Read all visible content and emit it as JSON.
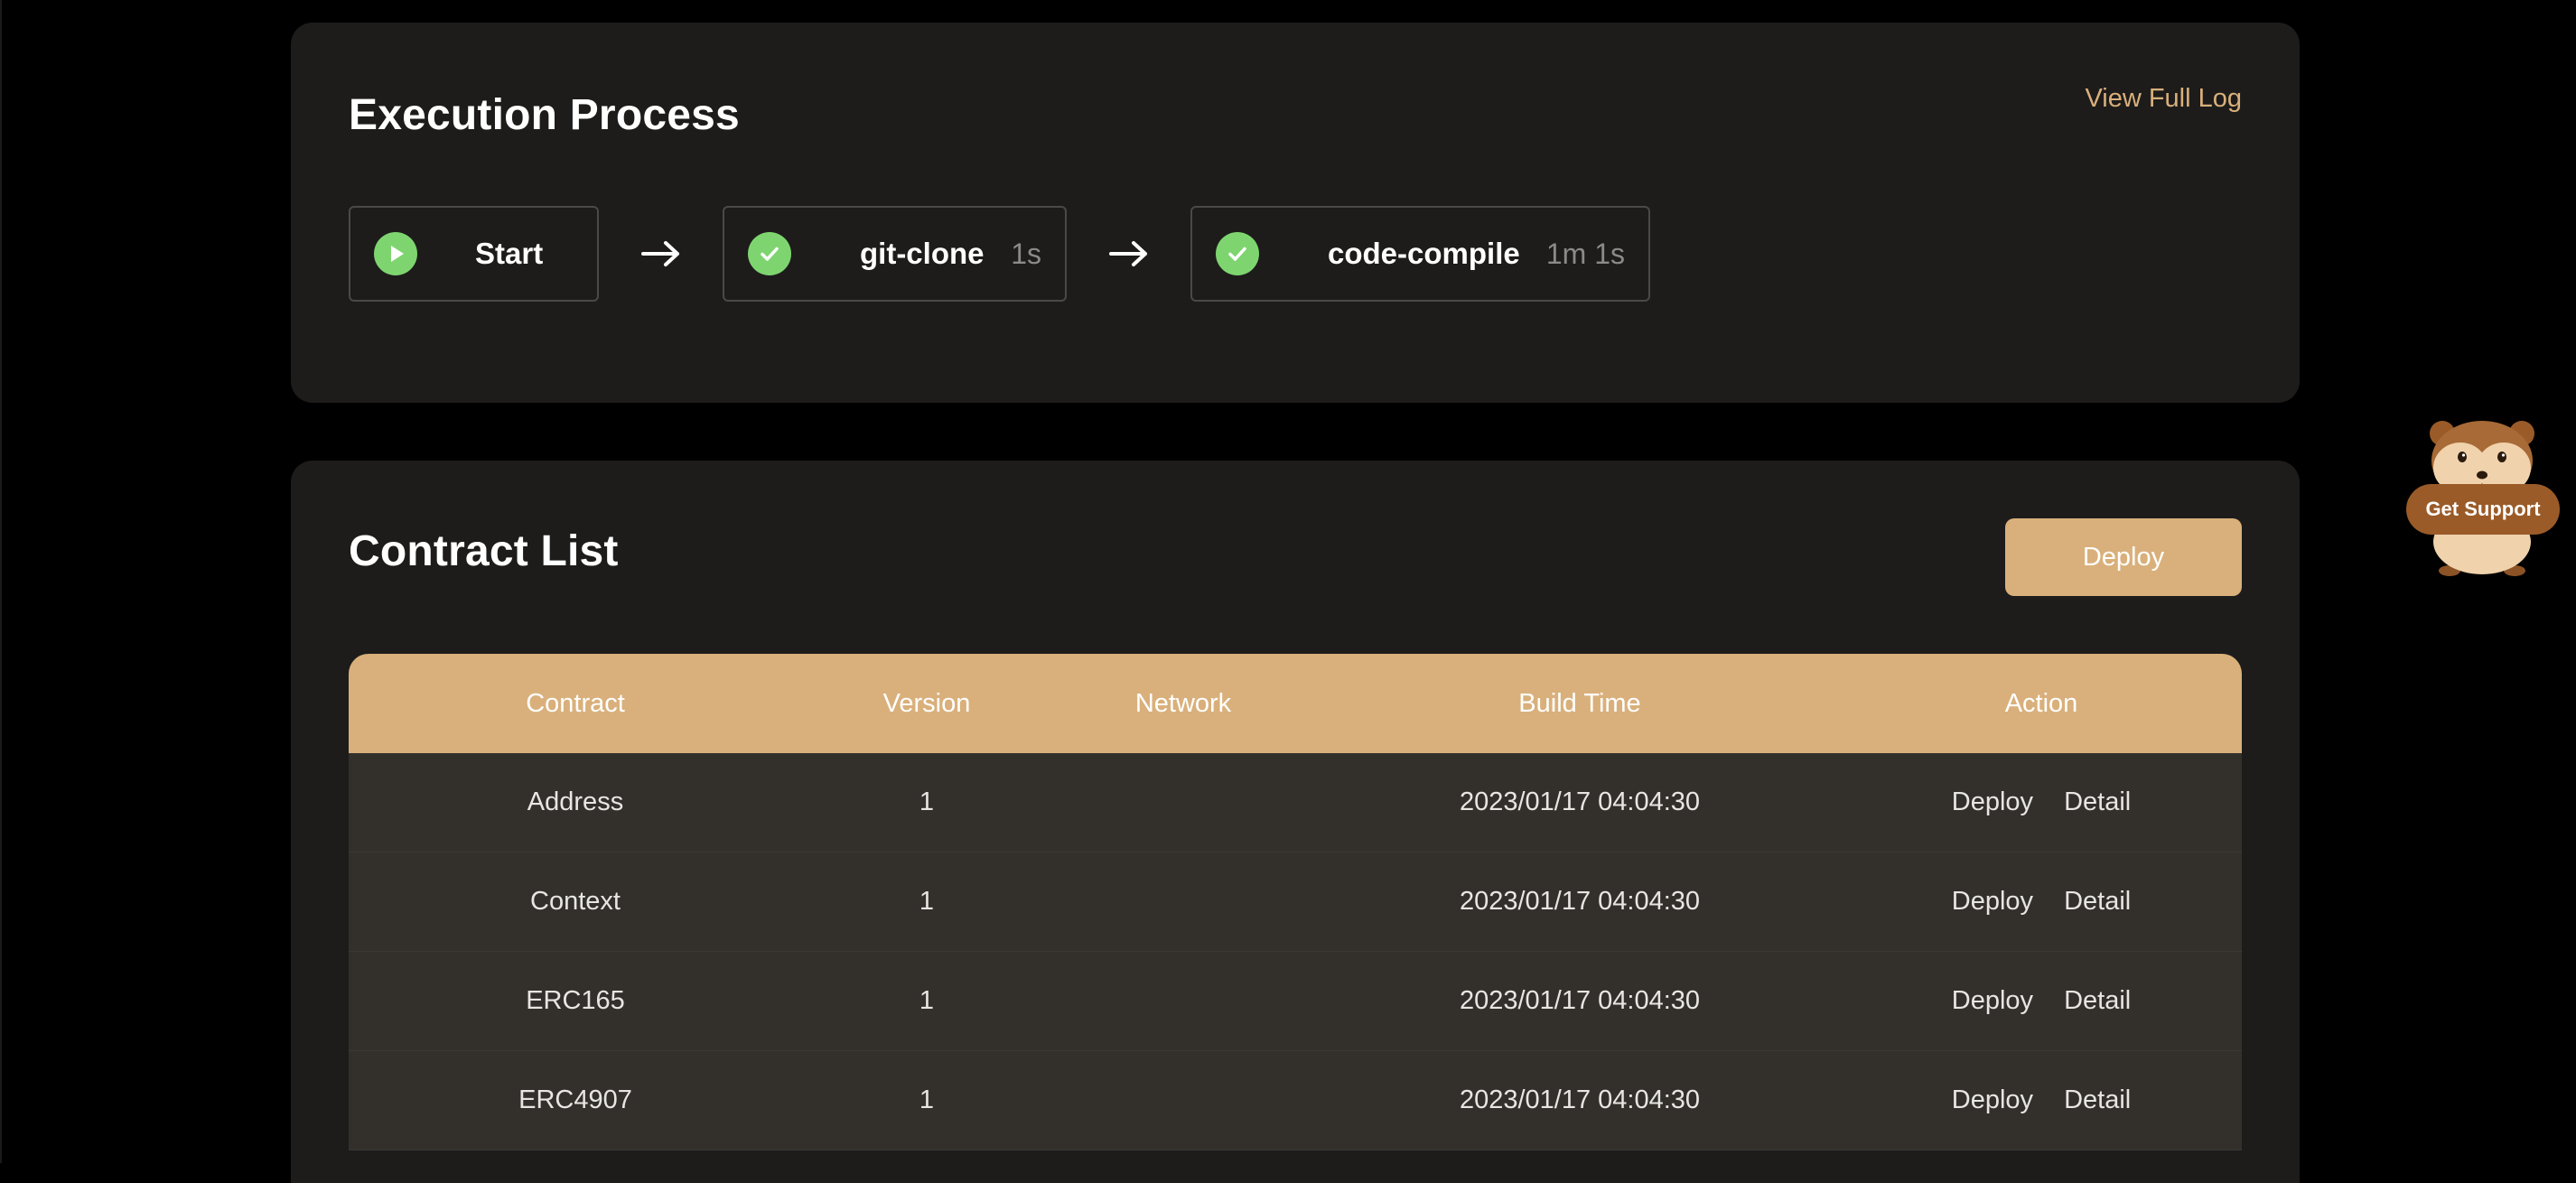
{
  "execution": {
    "title": "Execution Process",
    "view_log_label": "View Full Log",
    "steps": [
      {
        "name": "Start",
        "duration": "",
        "status": "running",
        "icon": "play-icon"
      },
      {
        "name": "git-clone",
        "duration": "1s",
        "status": "success",
        "icon": "check-icon"
      },
      {
        "name": "code-compile",
        "duration": "1m 1s",
        "status": "success",
        "icon": "check-icon"
      }
    ]
  },
  "contracts": {
    "title": "Contract List",
    "deploy_label": "Deploy",
    "columns": [
      "Contract",
      "Version",
      "Network",
      "Build Time",
      "Action"
    ],
    "rows": [
      {
        "contract": "Address",
        "version": "1",
        "network": "",
        "build_time": "2023/01/17 04:04:30",
        "deploy": "Deploy",
        "detail": "Detail"
      },
      {
        "contract": "Context",
        "version": "1",
        "network": "",
        "build_time": "2023/01/17 04:04:30",
        "deploy": "Deploy",
        "detail": "Detail"
      },
      {
        "contract": "ERC165",
        "version": "1",
        "network": "",
        "build_time": "2023/01/17 04:04:30",
        "deploy": "Deploy",
        "detail": "Detail"
      },
      {
        "contract": "ERC4907",
        "version": "1",
        "network": "",
        "build_time": "2023/01/17 04:04:30",
        "deploy": "Deploy",
        "detail": "Detail"
      }
    ]
  },
  "support": {
    "label": "Get Support",
    "icon": "hamster-mascot-icon"
  },
  "colors": {
    "accent": "#d9b07b",
    "success": "#7ed56f",
    "card_bg": "#1d1c1b",
    "row_bg": "#33302c"
  }
}
